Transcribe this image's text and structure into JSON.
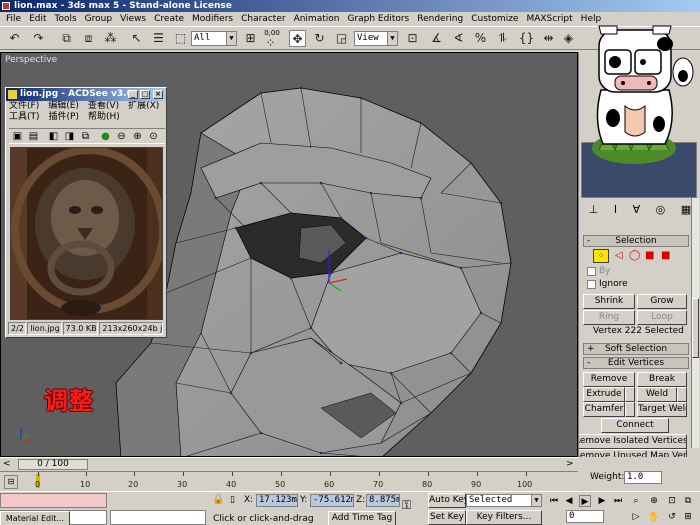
{
  "titlebar": {
    "title": "lion.max - 3ds max 5 - Stand-alone License"
  },
  "menu": [
    "File",
    "Edit",
    "Tools",
    "Group",
    "Views",
    "Create",
    "Modifiers",
    "Character",
    "Animation",
    "Graph Editors",
    "Rendering",
    "Customize",
    "MAXScript",
    "Help"
  ],
  "toolbar": {
    "selection_filter": "All",
    "ref_coord": "View",
    "snap_value": "3",
    "spinner_label": "0,00"
  },
  "viewport": {
    "label": "Perspective"
  },
  "acdsee": {
    "title": "lion.jpg - ACDSee v3.0",
    "menu": [
      "文件(F)",
      "编辑(E)",
      "查看(V)",
      "扩展(X)",
      "工具(T)",
      "插件(P)",
      "帮助(H)"
    ],
    "status": {
      "index": "2/2",
      "filename": "lion.jpg",
      "size": "73.0 KB",
      "dims": "213x260x24b j"
    }
  },
  "overlay_text": "调整",
  "command_panel": {
    "selection_rollout": "Selection",
    "by_label": "By",
    "ignore_label": "Ignore",
    "shrink": "Shrink",
    "grow": "Grow",
    "ring": "Ring",
    "loop": "Loop",
    "selection_status": "Vertex 222 Selected",
    "soft_selection_rollout": "Soft Selection",
    "edit_vertices_rollout": "Edit Vertices",
    "remove": "Remove",
    "break": "Break",
    "extrude": "Extrude",
    "weld": "Weld",
    "chamfer": "Chamfer",
    "target_weld": "Target Weld",
    "connect": "Connect",
    "remove_isolated": "Remove Isolated Vertices",
    "remove_unused": "Remove Unused Map Verts",
    "weight_label": "Weight:",
    "weight_value": "1.0"
  },
  "timeline": {
    "frame_display": "0 / 100",
    "ticks": [
      "0",
      "10",
      "20",
      "30",
      "40",
      "50",
      "60",
      "70",
      "80",
      "90",
      "100"
    ]
  },
  "status": {
    "x_label": "X:",
    "x_value": "17.123m",
    "y_label": "Y:",
    "y_value": "-75.612m",
    "z_label": "Z:",
    "z_value": "8.875m",
    "prompt": "Click or click-and-drag",
    "add_time_tag": "Add Time Tag",
    "auto_key": "Auto Key",
    "set_key": "Set Key",
    "key_mode": "Selected",
    "key_filters": "Key Filters...",
    "frame_field": "0",
    "material_editor": "Material Edit..."
  }
}
